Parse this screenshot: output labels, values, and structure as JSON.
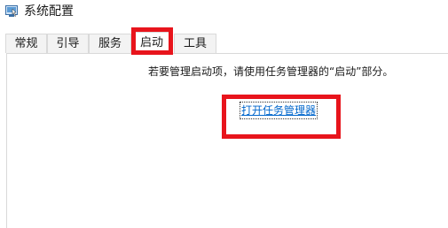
{
  "window": {
    "title": "系统配置",
    "icon": "system-config-icon"
  },
  "tabs": [
    {
      "label": "常规",
      "active": false
    },
    {
      "label": "引导",
      "active": false
    },
    {
      "label": "服务",
      "active": false
    },
    {
      "label": "启动",
      "active": true
    },
    {
      "label": "工具",
      "active": false
    }
  ],
  "startup": {
    "info_text": "若要管理启动项，请使用任务管理器的“启动”部分。",
    "task_manager_link": "打开任务管理器"
  },
  "annotations": {
    "highlight_color": "#e8141c"
  }
}
